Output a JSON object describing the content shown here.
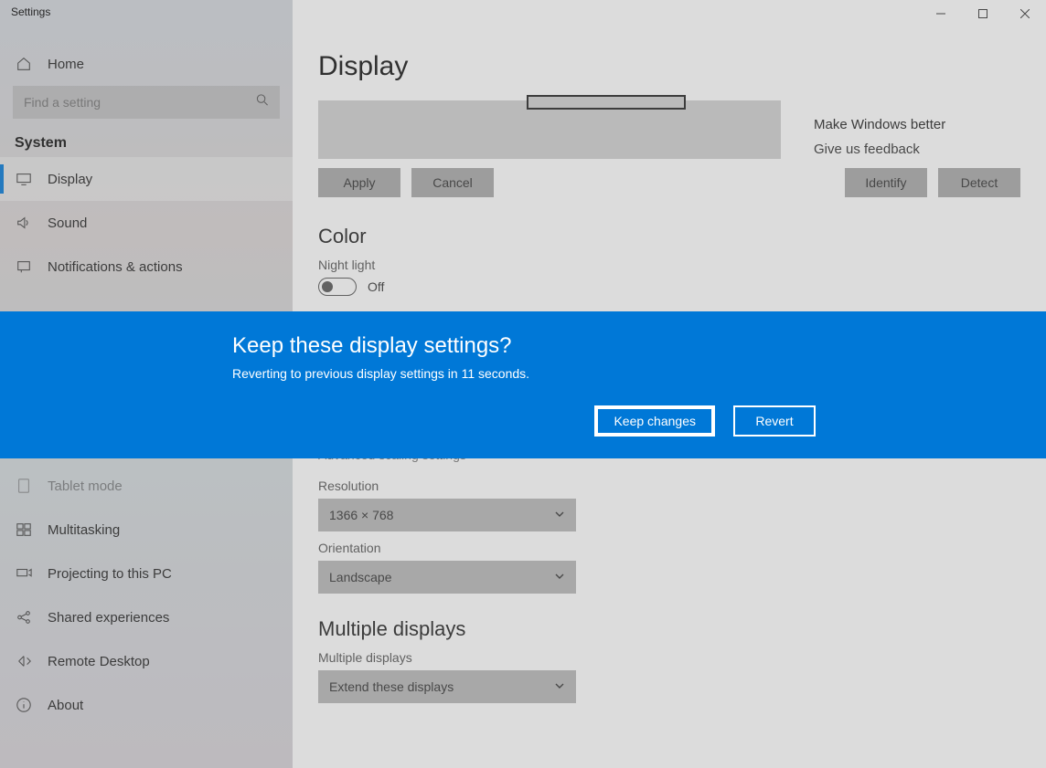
{
  "window": {
    "title": "Settings"
  },
  "home": {
    "label": "Home"
  },
  "search": {
    "placeholder": "Find a setting"
  },
  "category": {
    "label": "System"
  },
  "nav": [
    {
      "label": "Display"
    },
    {
      "label": "Sound"
    },
    {
      "label": "Notifications & actions"
    },
    {
      "label": "Tablet mode"
    },
    {
      "label": "Multitasking"
    },
    {
      "label": "Projecting to this PC"
    },
    {
      "label": "Shared experiences"
    },
    {
      "label": "Remote Desktop"
    },
    {
      "label": "About"
    }
  ],
  "page": {
    "title": "Display"
  },
  "buttons": {
    "apply": "Apply",
    "cancel": "Cancel",
    "identify": "Identify",
    "detect": "Detect"
  },
  "sections": {
    "color": "Color",
    "multiple": "Multiple displays"
  },
  "nightlight": {
    "label": "Night light",
    "value": "Off"
  },
  "scaling_link": "Advanced scaling settings",
  "resolution": {
    "label": "Resolution",
    "value": "1366 × 768"
  },
  "orientation": {
    "label": "Orientation",
    "value": "Landscape"
  },
  "multi": {
    "label": "Multiple displays",
    "value": "Extend these displays"
  },
  "rightcol": {
    "title": "Make Windows better",
    "link": "Give us feedback"
  },
  "dialog": {
    "title": "Keep these display settings?",
    "message": "Reverting to previous display settings in 11 seconds.",
    "keep": "Keep changes",
    "revert": "Revert"
  }
}
